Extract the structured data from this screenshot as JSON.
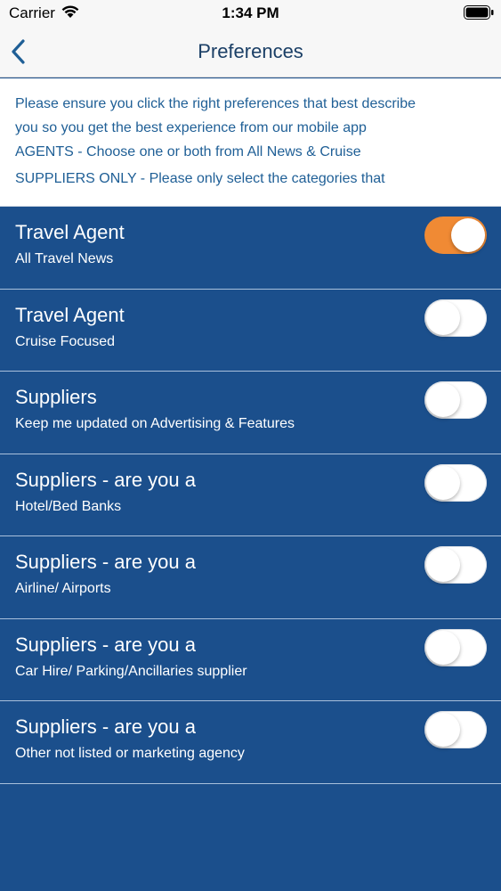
{
  "status": {
    "carrier": "Carrier",
    "time": "1:34 PM"
  },
  "nav": {
    "title": "Preferences",
    "back_icon": "chevron-left-icon"
  },
  "intro": {
    "lines": [
      "Please ensure you click the right preferences that best describe",
      "you so you get the best experience from our mobile app",
      "AGENTS - Choose one or both from All News & Cruise",
      "SUPPLIERS ONLY - Please only select the categories that"
    ]
  },
  "colors": {
    "accent_on": "#f08a34",
    "list_bg": "#1b4f8c",
    "intro_text": "#1f5f96"
  },
  "preferences": [
    {
      "title": "Travel Agent",
      "subtitle": "All Travel News",
      "on": true
    },
    {
      "title": "Travel Agent",
      "subtitle": "Cruise Focused",
      "on": false
    },
    {
      "title": "Suppliers",
      "subtitle": "Keep me updated on Advertising & Features",
      "on": false
    },
    {
      "title": "Suppliers - are you a",
      "subtitle": "Hotel/Bed Banks",
      "on": false
    },
    {
      "title": "Suppliers - are you a",
      "subtitle": "Airline/ Airports",
      "on": false
    },
    {
      "title": "Suppliers - are you a",
      "subtitle": "Car Hire/ Parking/Ancillaries supplier",
      "on": false
    },
    {
      "title": "Suppliers - are you a",
      "subtitle": "Other not listed or marketing agency",
      "on": false
    }
  ]
}
